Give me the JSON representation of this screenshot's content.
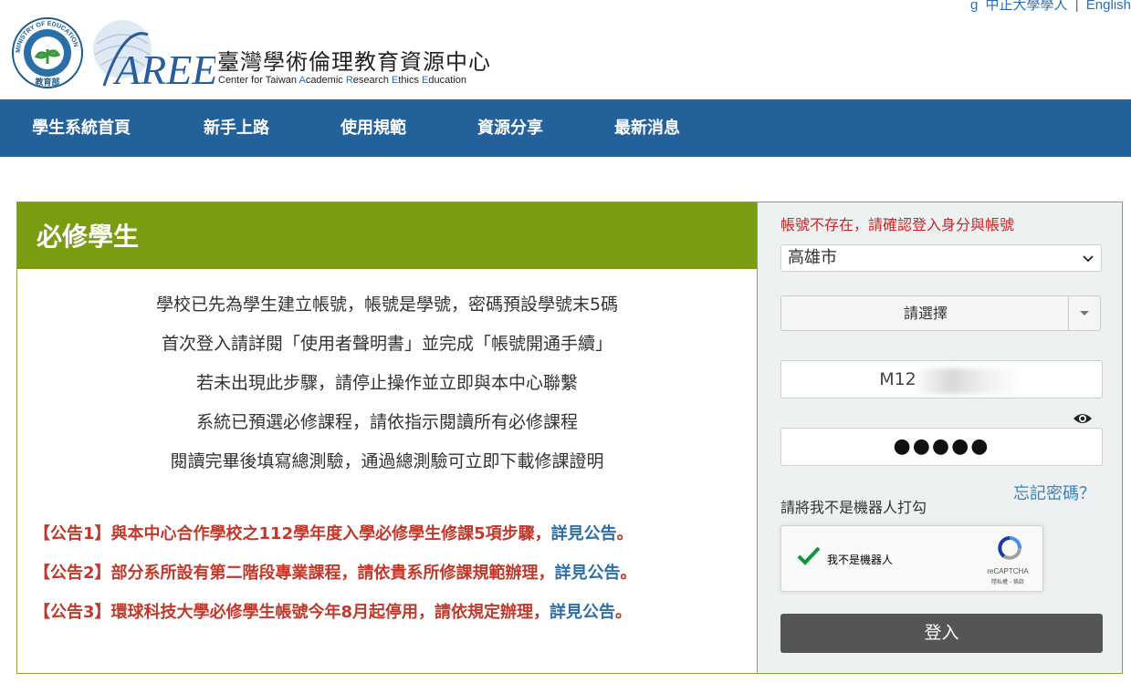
{
  "header": {
    "top_links": [
      "g",
      "中正大學學人",
      "|",
      "English"
    ],
    "title": "臺灣學術倫理教育資源中心",
    "subtitle_parts": [
      {
        "text": "Center for Taiwan ",
        "hl": false
      },
      {
        "text": "A",
        "hl": true
      },
      {
        "text": "cademic ",
        "hl": false
      },
      {
        "text": "R",
        "hl": true
      },
      {
        "text": "esearch ",
        "hl": false
      },
      {
        "text": "E",
        "hl": true
      },
      {
        "text": "thics ",
        "hl": false
      },
      {
        "text": "E",
        "hl": true
      },
      {
        "text": "ducation",
        "hl": false
      }
    ],
    "ministry_logo_text": "MINISTRY OF EDUCATION",
    "ministry_logo_cn": "教育部",
    "aree_logo_text": "AREE"
  },
  "nav": {
    "items": [
      "學生系統首頁",
      "新手上路",
      "使用規範",
      "資源分享",
      "最新消息"
    ]
  },
  "main": {
    "section_title": "必修學生",
    "intro_lines": [
      "學校已先為學生建立帳號，帳號是學號，密碼預設學號末5碼",
      "首次登入請詳閱「使用者聲明書」並完成「帳號開通手續」",
      "若未出現此步驟，請停止操作並立即與本中心聯繫",
      "系統已預選必修課程，請依指示閱讀所有必修課程",
      "閱讀完畢後填寫總測驗，通過總測驗可立即下載修課證明"
    ],
    "notices": [
      {
        "text": "【公告1】與本中心合作學校之112學年度入學必修學生修課5項步驟，",
        "link": "詳見公告",
        "end": "。"
      },
      {
        "text": "【公告2】部分系所設有第二階段專業課程，請依貴系所修課規範辦理，",
        "link": "詳見公告",
        "end": "。"
      },
      {
        "text": "【公告3】環球科技大學必修學生帳號今年8月起停用，請依規定辦理，",
        "link": "詳見公告",
        "end": "。"
      }
    ]
  },
  "login": {
    "error": "帳號不存在，請確認登入身分與帳號",
    "city_value": "高雄市",
    "school_placeholder": "請選擇",
    "account_value": "M12",
    "password_mask": "●●●●●",
    "forgot": "忘記密碼？",
    "captcha_hint": "請將我不是機器人打勾",
    "recaptcha_label": "我不是機器人",
    "recaptcha_brand": "reCAPTCHA",
    "recaptcha_terms": "隱私權 - 條款",
    "submit": "登入"
  },
  "colors": {
    "nav_bg": "#23619a",
    "section_header_bg": "#7a9c10",
    "error": "#c62828",
    "notice": "#c0392b",
    "link": "#2f6fa8",
    "login_button": "#555555"
  }
}
